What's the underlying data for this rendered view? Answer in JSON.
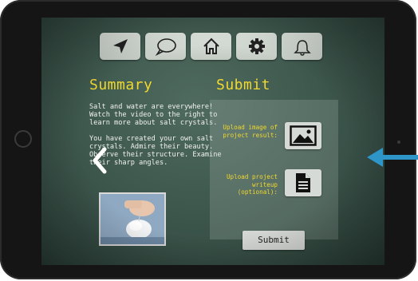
{
  "toolbar": {
    "items": [
      {
        "icon": "navigation-arrow-icon"
      },
      {
        "icon": "chat-bubble-icon"
      },
      {
        "icon": "home-icon"
      },
      {
        "icon": "settings-gear-icon"
      },
      {
        "icon": "bell-icon"
      }
    ]
  },
  "summary": {
    "title": "Summary",
    "paragraph1": "Salt and water are everywhere!  Watch the video to the right to learn more about salt crystals.",
    "paragraph2": "You have created your own salt crystals.  Admire their beauty.  Observe their structure.  Examine their sharp angles."
  },
  "submit": {
    "title": "Submit",
    "upload_image_label": "Upload image of project result:",
    "upload_writeup_label": "Upload project writeup (optional):",
    "submit_label": "Submit"
  },
  "colors": {
    "accent_yellow": "#f1d92e",
    "chalkboard": "#3e584e",
    "indicator_arrow": "#2e95c9"
  }
}
